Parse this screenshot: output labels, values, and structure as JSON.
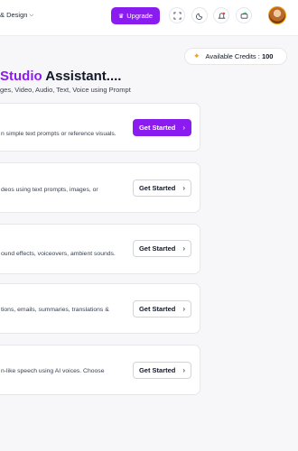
{
  "header": {
    "nav_label": "& Design",
    "upgrade_label": "Upgrade",
    "icons": [
      "expand-icon",
      "moon-icon",
      "bell-icon",
      "wallet-icon"
    ],
    "accent_color": "#8b1cf0"
  },
  "credits": {
    "label": "Available Credits :",
    "value": "100"
  },
  "hero": {
    "title_accent": "Studio",
    "title_rest": " Assistant....",
    "subtitle": "ges, Video, Audio, Text, Voice using Prompt"
  },
  "cards": [
    {
      "desc": "n simple text prompts or reference visuals.",
      "cta": "Get Started",
      "style": "primary"
    },
    {
      "desc": "deos using text prompts, images, or",
      "cta": "Get Started",
      "style": "secondary"
    },
    {
      "desc": "ound effects, voiceovers, ambient sounds.",
      "cta": "Get Started",
      "style": "secondary"
    },
    {
      "desc": "tions, emails, summaries, translations &",
      "cta": "Get Started",
      "style": "secondary"
    },
    {
      "desc": "n-like speech using AI voices. Choose",
      "cta": "Get Started",
      "style": "secondary"
    }
  ]
}
